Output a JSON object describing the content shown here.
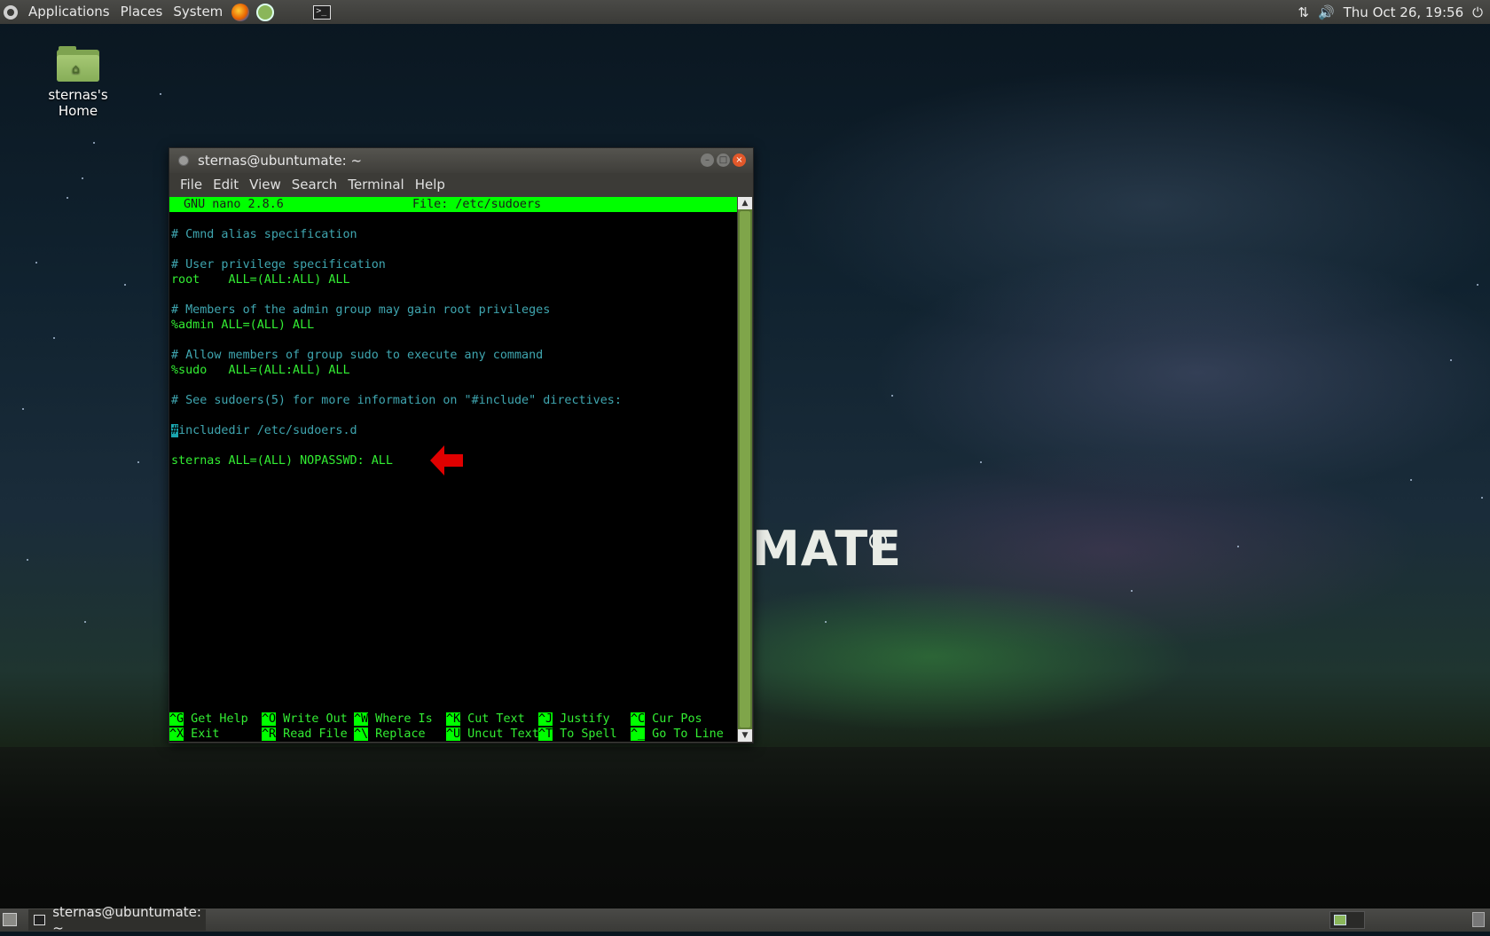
{
  "top_panel": {
    "menus": [
      "Applications",
      "Places",
      "System"
    ],
    "clock": "Thu Oct 26, 19:56"
  },
  "desktop": {
    "home_icon_label": "sternas's Home",
    "wallpaper_brand": "MATE"
  },
  "window": {
    "title": "sternas@ubuntumate: ~",
    "menu": [
      "File",
      "Edit",
      "View",
      "Search",
      "Terminal",
      "Help"
    ]
  },
  "nano": {
    "version": "GNU nano 2.8.6",
    "file": "File: /etc/sudoers",
    "lines": {
      "cmnd_alias": "# Cmnd alias specification",
      "user_priv": "# User privilege specification",
      "root": "root    ALL=(ALL:ALL) ALL",
      "admin_comment": "# Members of the admin group may gain root privileges",
      "admin": "%admin ALL=(ALL) ALL",
      "sudo_comment": "# Allow members of group sudo to execute any command",
      "sudo": "%sudo   ALL=(ALL:ALL) ALL",
      "include_comment": "# See sudoers(5) for more information on \"#include\" directives:",
      "includedir_cursor": "#",
      "includedir_rest": "includedir /etc/sudoers.d",
      "sternas": "sternas ALL=(ALL) NOPASSWD: ALL"
    },
    "shortcuts_row1": [
      {
        "key": "^G",
        "label": " Get Help"
      },
      {
        "key": "^O",
        "label": " Write Out"
      },
      {
        "key": "^W",
        "label": " Where Is"
      },
      {
        "key": "^K",
        "label": " Cut Text"
      },
      {
        "key": "^J",
        "label": " Justify"
      },
      {
        "key": "^C",
        "label": " Cur Pos"
      }
    ],
    "shortcuts_row2": [
      {
        "key": "^X",
        "label": " Exit"
      },
      {
        "key": "^R",
        "label": " Read File"
      },
      {
        "key": "^\\",
        "label": " Replace"
      },
      {
        "key": "^U",
        "label": " Uncut Text"
      },
      {
        "key": "^T",
        "label": " To Spell"
      },
      {
        "key": "^_",
        "label": " Go To Line"
      }
    ]
  },
  "bottom_panel": {
    "task_title": "sternas@ubuntumate: ~"
  },
  "colors": {
    "nano_green": "#00ff00",
    "comment_cyan": "#3fa6b0",
    "arrow_red": "#e00000"
  }
}
